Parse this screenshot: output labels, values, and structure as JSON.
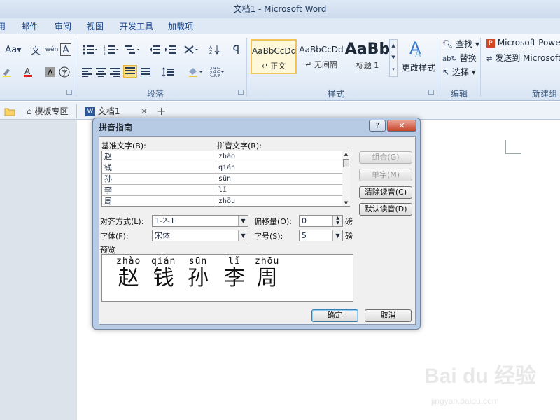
{
  "window": {
    "title": "文档1 - Microsoft Word"
  },
  "ribbon_tabs": [
    "用",
    "邮件",
    "审阅",
    "视图",
    "开发工具",
    "加载项"
  ],
  "ribbon": {
    "groups": {
      "paragraph": "段落",
      "styles": "样式",
      "editing": "编辑",
      "new_group": "新建组"
    },
    "font_buttons": [
      "Aa▾",
      "文",
      "wén",
      "A"
    ],
    "styles": [
      {
        "sample": "AaBbCcDd",
        "name": "↵ 正文",
        "selected": true
      },
      {
        "sample": "AaBbCcDd",
        "name": "↵ 无间隔",
        "selected": false
      },
      {
        "sample": "AaBb",
        "name": "标题 1",
        "selected": false
      }
    ],
    "change_styles": "更改样式",
    "editing": {
      "find": "查找 ▾",
      "replace": "替换",
      "select": "选择 ▾"
    },
    "powerpoint": {
      "item1": "Microsoft PowerI",
      "item2": "发送到 Microsoft"
    }
  },
  "doc_tabs": {
    "templates": "模板专区",
    "doc": "文档1",
    "close": "✕",
    "add": "+"
  },
  "dialog": {
    "title": "拼音指南",
    "help": "?",
    "close": "✕",
    "base_text_label": "基准文字(B):",
    "ruby_text_label": "拼音文字(R):",
    "rows": [
      {
        "base": "赵",
        "ruby": "zhào"
      },
      {
        "base": "钱",
        "ruby": "qián"
      },
      {
        "base": "孙",
        "ruby": "sūn"
      },
      {
        "base": "李",
        "ruby": "lǐ"
      },
      {
        "base": "周",
        "ruby": "zhōu"
      }
    ],
    "buttons": {
      "group": "组合(G)",
      "mono": "单字(M)",
      "clear": "清除读音(C)",
      "default": "默认读音(D)",
      "ok": "确定",
      "cancel": "取消"
    },
    "alignment": {
      "label": "对齐方式(L):",
      "value": "1-2-1"
    },
    "offset": {
      "label": "偏移量(O):",
      "value": "0",
      "unit": "磅"
    },
    "font": {
      "label": "字体(F):",
      "value": "宋体"
    },
    "size": {
      "label": "字号(S):",
      "value": "5",
      "unit": "磅"
    },
    "preview_label": "预览",
    "preview": [
      {
        "py": "zhào",
        "ch": "赵"
      },
      {
        "py": "qián",
        "ch": "钱"
      },
      {
        "py": "sūn",
        "ch": "孙"
      },
      {
        "py": "lǐ",
        "ch": "李"
      },
      {
        "py": "zhōu",
        "ch": "周"
      }
    ]
  },
  "watermark": {
    "main": "Bai du 经验",
    "sub": "jingyan.baidu.com"
  }
}
